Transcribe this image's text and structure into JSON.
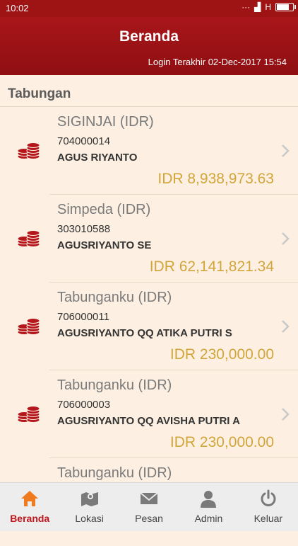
{
  "status_bar": {
    "time": "10:02",
    "signal_text": "H"
  },
  "header": {
    "title": "Beranda",
    "last_login": "Login Terakhir 02-Dec-2017 15:54"
  },
  "section": {
    "title": "Tabungan"
  },
  "accounts": [
    {
      "name": "SIGINJAI (IDR)",
      "number": "704000014",
      "holder": "AGUS RIYANTO",
      "balance": "IDR 8,938,973.63"
    },
    {
      "name": "Simpeda (IDR)",
      "number": "303010588",
      "holder": "AGUSRIYANTO SE",
      "balance": "IDR 62,141,821.34"
    },
    {
      "name": "Tabunganku (IDR)",
      "number": "706000011",
      "holder": "AGUSRIYANTO QQ ATIKA PUTRI S",
      "balance": "IDR 230,000.00"
    },
    {
      "name": "Tabunganku (IDR)",
      "number": "706000003",
      "holder": "AGUSRIYANTO QQ AVISHA PUTRI A",
      "balance": "IDR 230,000.00"
    },
    {
      "name": "Tabunganku (IDR)",
      "number": "",
      "holder": "",
      "balance": ""
    }
  ],
  "nav": {
    "beranda": "Beranda",
    "lokasi": "Lokasi",
    "pesan": "Pesan",
    "admin": "Admin",
    "keluar": "Keluar"
  },
  "colors": {
    "brand_red": "#9e1414",
    "balance_gold": "#d2a53a",
    "background": "#fdf0e2",
    "nav_active": "#c0161b"
  },
  "icons": [
    "coins-icon",
    "chevron-right-icon",
    "home-icon",
    "map-icon",
    "mail-icon",
    "user-icon",
    "power-icon"
  ]
}
